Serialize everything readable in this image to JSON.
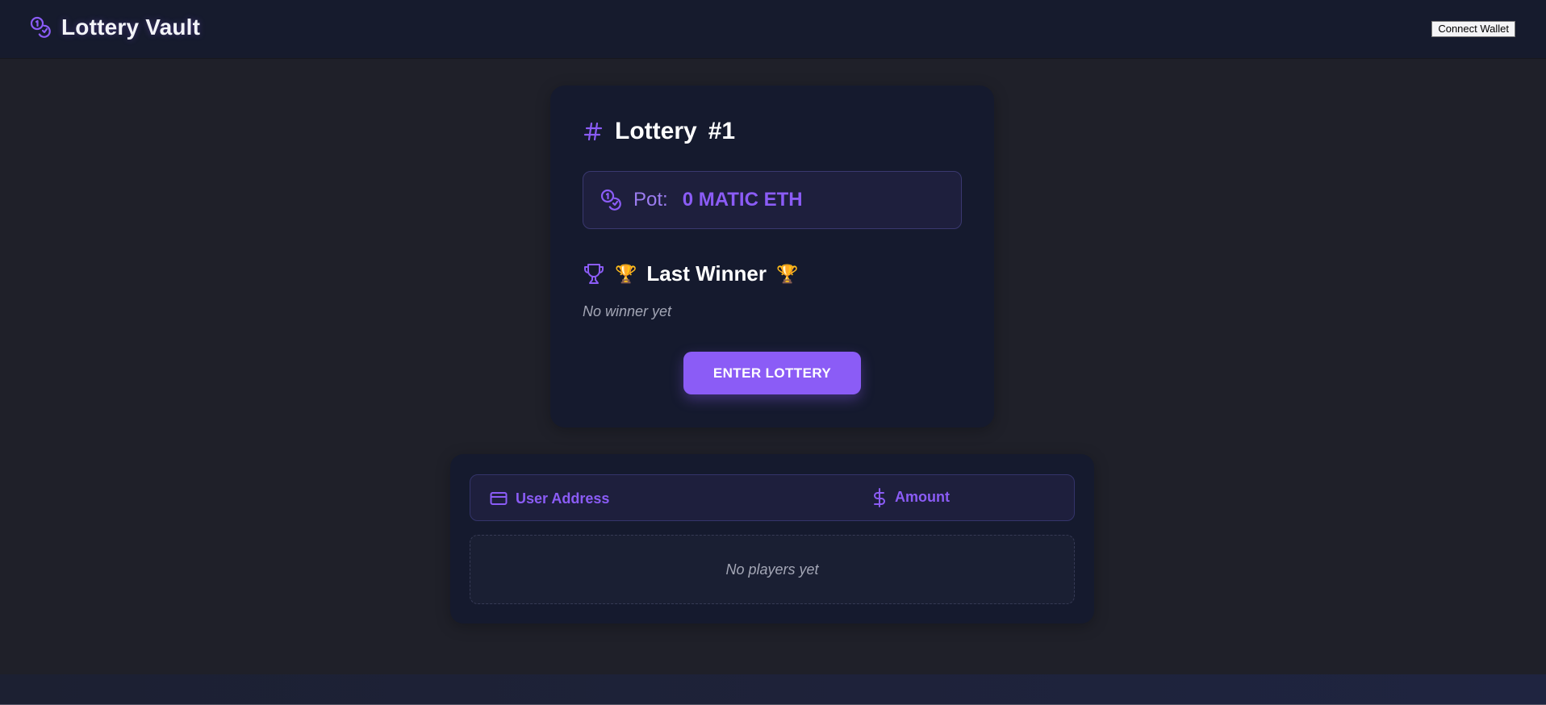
{
  "header": {
    "brand_icon": "coins-icon",
    "brand_title": "Lottery Vault",
    "connect_label": "Connect Wallet"
  },
  "lottery": {
    "title_icon": "hash-icon",
    "title_label": "Lottery",
    "title_number": "#1",
    "pot": {
      "icon": "coins-icon",
      "label": "Pot:",
      "value": "0 MATIC ETH"
    },
    "winner": {
      "icon": "trophy-icon",
      "emoji_left": "🏆",
      "heading": "Last Winner",
      "emoji_right": "🏆",
      "empty_text": "No winner yet"
    },
    "enter_label": "ENTER LOTTERY"
  },
  "players": {
    "columns": [
      {
        "icon": "credit-card-icon",
        "label": "User Address"
      },
      {
        "icon": "dollar-icon",
        "label": "Amount"
      }
    ],
    "empty_text": "No players yet"
  },
  "colors": {
    "accent": "#8b5cf6",
    "background": "#1f2029",
    "card": "#151a2e"
  }
}
